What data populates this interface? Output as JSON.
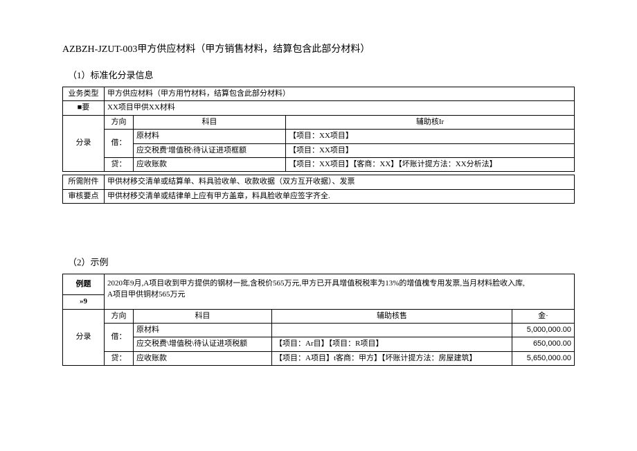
{
  "title": "AZBZH-JZUT-003甲方供应材料（甲方销售材料，结算包含此部分材料）",
  "section1": {
    "heading": "（1）标准化分录信息",
    "rows": {
      "biztype_label": "业务类型",
      "biztype_value": "甲方供应材料（甲方用竹材料，结算包含此部分材料）",
      "summary_label": "■要",
      "summary_value": "XX项目甲供XX材料",
      "entry_label": "分录",
      "h_dir": "方向",
      "h_subject": "科目",
      "h_aux": "辅助核Ir",
      "dr": "借：",
      "cr": "贷：",
      "sub1": "原材料",
      "sub2": "应交税费'增值税\\待认证进项框额",
      "sub3": "应收账款",
      "aux1": "【项目：XX项目】",
      "aux2": "【项目：XX项目】",
      "aux3": "【项目：XX项目】【客商：XX】【坏账计提方法：XX分析法】",
      "attach_label": "所需附件",
      "attach_value": "甲供材移交清单或结算单、料具验收单、收款收据（双方互开收据）、发票",
      "audit_label": "审核要点",
      "audit_value": "甲供材移交清单或结律单上应有甲方盖章，料具脸收单应签字齐全."
    }
  },
  "section2": {
    "heading": "（2）示例",
    "example_label": "例题",
    "example_num": "»9",
    "example_text1": "2020年9月,A项目收到甲方提供的钢材一批,含税价565万元,甲方已开具增值税税率为13%的增值槐专用发票,当月材料脸收入库,",
    "example_text2": "A项目甲供铜材565万元",
    "entry_label": "分录",
    "h_dir": "方向",
    "h_subject": "科目",
    "h_aux": "辅助核售",
    "h_amt": "金·",
    "dr": "借：",
    "cr": "贷：",
    "rows": [
      {
        "subject": "原材料",
        "aux": "",
        "amount": "5,000,000.00"
      },
      {
        "subject": "应交税费\\增值税\\待认证进项税额",
        "aux": "【项目：Ar目】【项目：R项目】",
        "amount": "650,000.00"
      },
      {
        "subject": "应收账款",
        "aux": "【项目：A项目】t客商：甲方】【坏账计提方法：房屋建筑】",
        "amount": "5,650,000.00"
      }
    ]
  }
}
